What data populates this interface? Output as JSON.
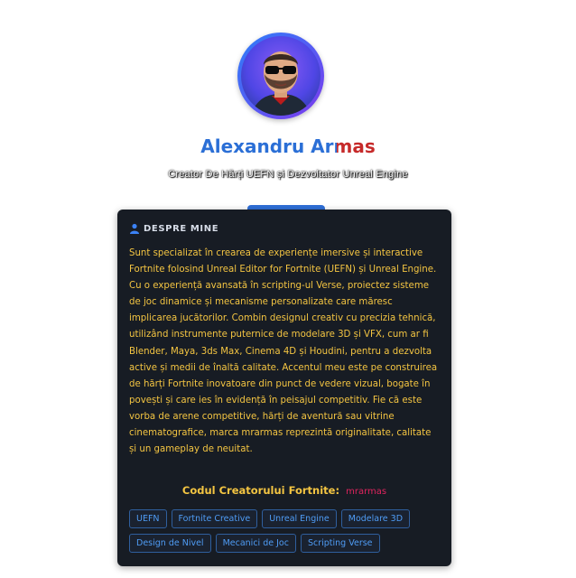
{
  "profile": {
    "first_name": "Alexandru",
    "last_name": "Armas",
    "subtitle": "Creator De Hărți UEFN și Dezvoltator Unreal Engine"
  },
  "about": {
    "title": "DESPRE MINE",
    "icon": "user-icon",
    "bio": "Sunt specializat în crearea de experiențe imersive și interactive Fortnite folosind Unreal Editor for Fortnite (UEFN) și Unreal Engine. Cu o experiență avansată în scripting-ul Verse, proiectez sisteme de joc dinamice și mecanisme personalizate care măresc implicarea jucătorilor. Combin designul creativ cu precizia tehnică, utilizând instrumente puternice de modelare 3D și VFX, cum ar fi Blender, Maya, 3ds Max, Cinema 4D și Houdini, pentru a dezvolta active și medii de înaltă calitate. Accentul meu este pe construirea de hărți Fortnite inovatoare din punct de vedere vizual, bogate în povești și care ies în evidență în peisajul competitiv. Fie că este vorba de arene competitive, hărți de aventură sau vitrine cinematografice, marca mrarmas reprezintă originalitate, calitate și un gameplay de neuitat.",
    "creator_code_label": "Codul Creatorului Fortnite:",
    "creator_code_value": "mrarmas"
  },
  "tags": [
    "UEFN",
    "Fortnite Creative",
    "Unreal Engine",
    "Modelare 3D",
    "Design de Nivel",
    "Mecanici de Joc",
    "Scripting Verse"
  ],
  "colors": {
    "card_background": "#171c24",
    "accent_blue": "#2f6fd8",
    "bio_text": "#f4c542",
    "code_value": "#e0245e"
  }
}
